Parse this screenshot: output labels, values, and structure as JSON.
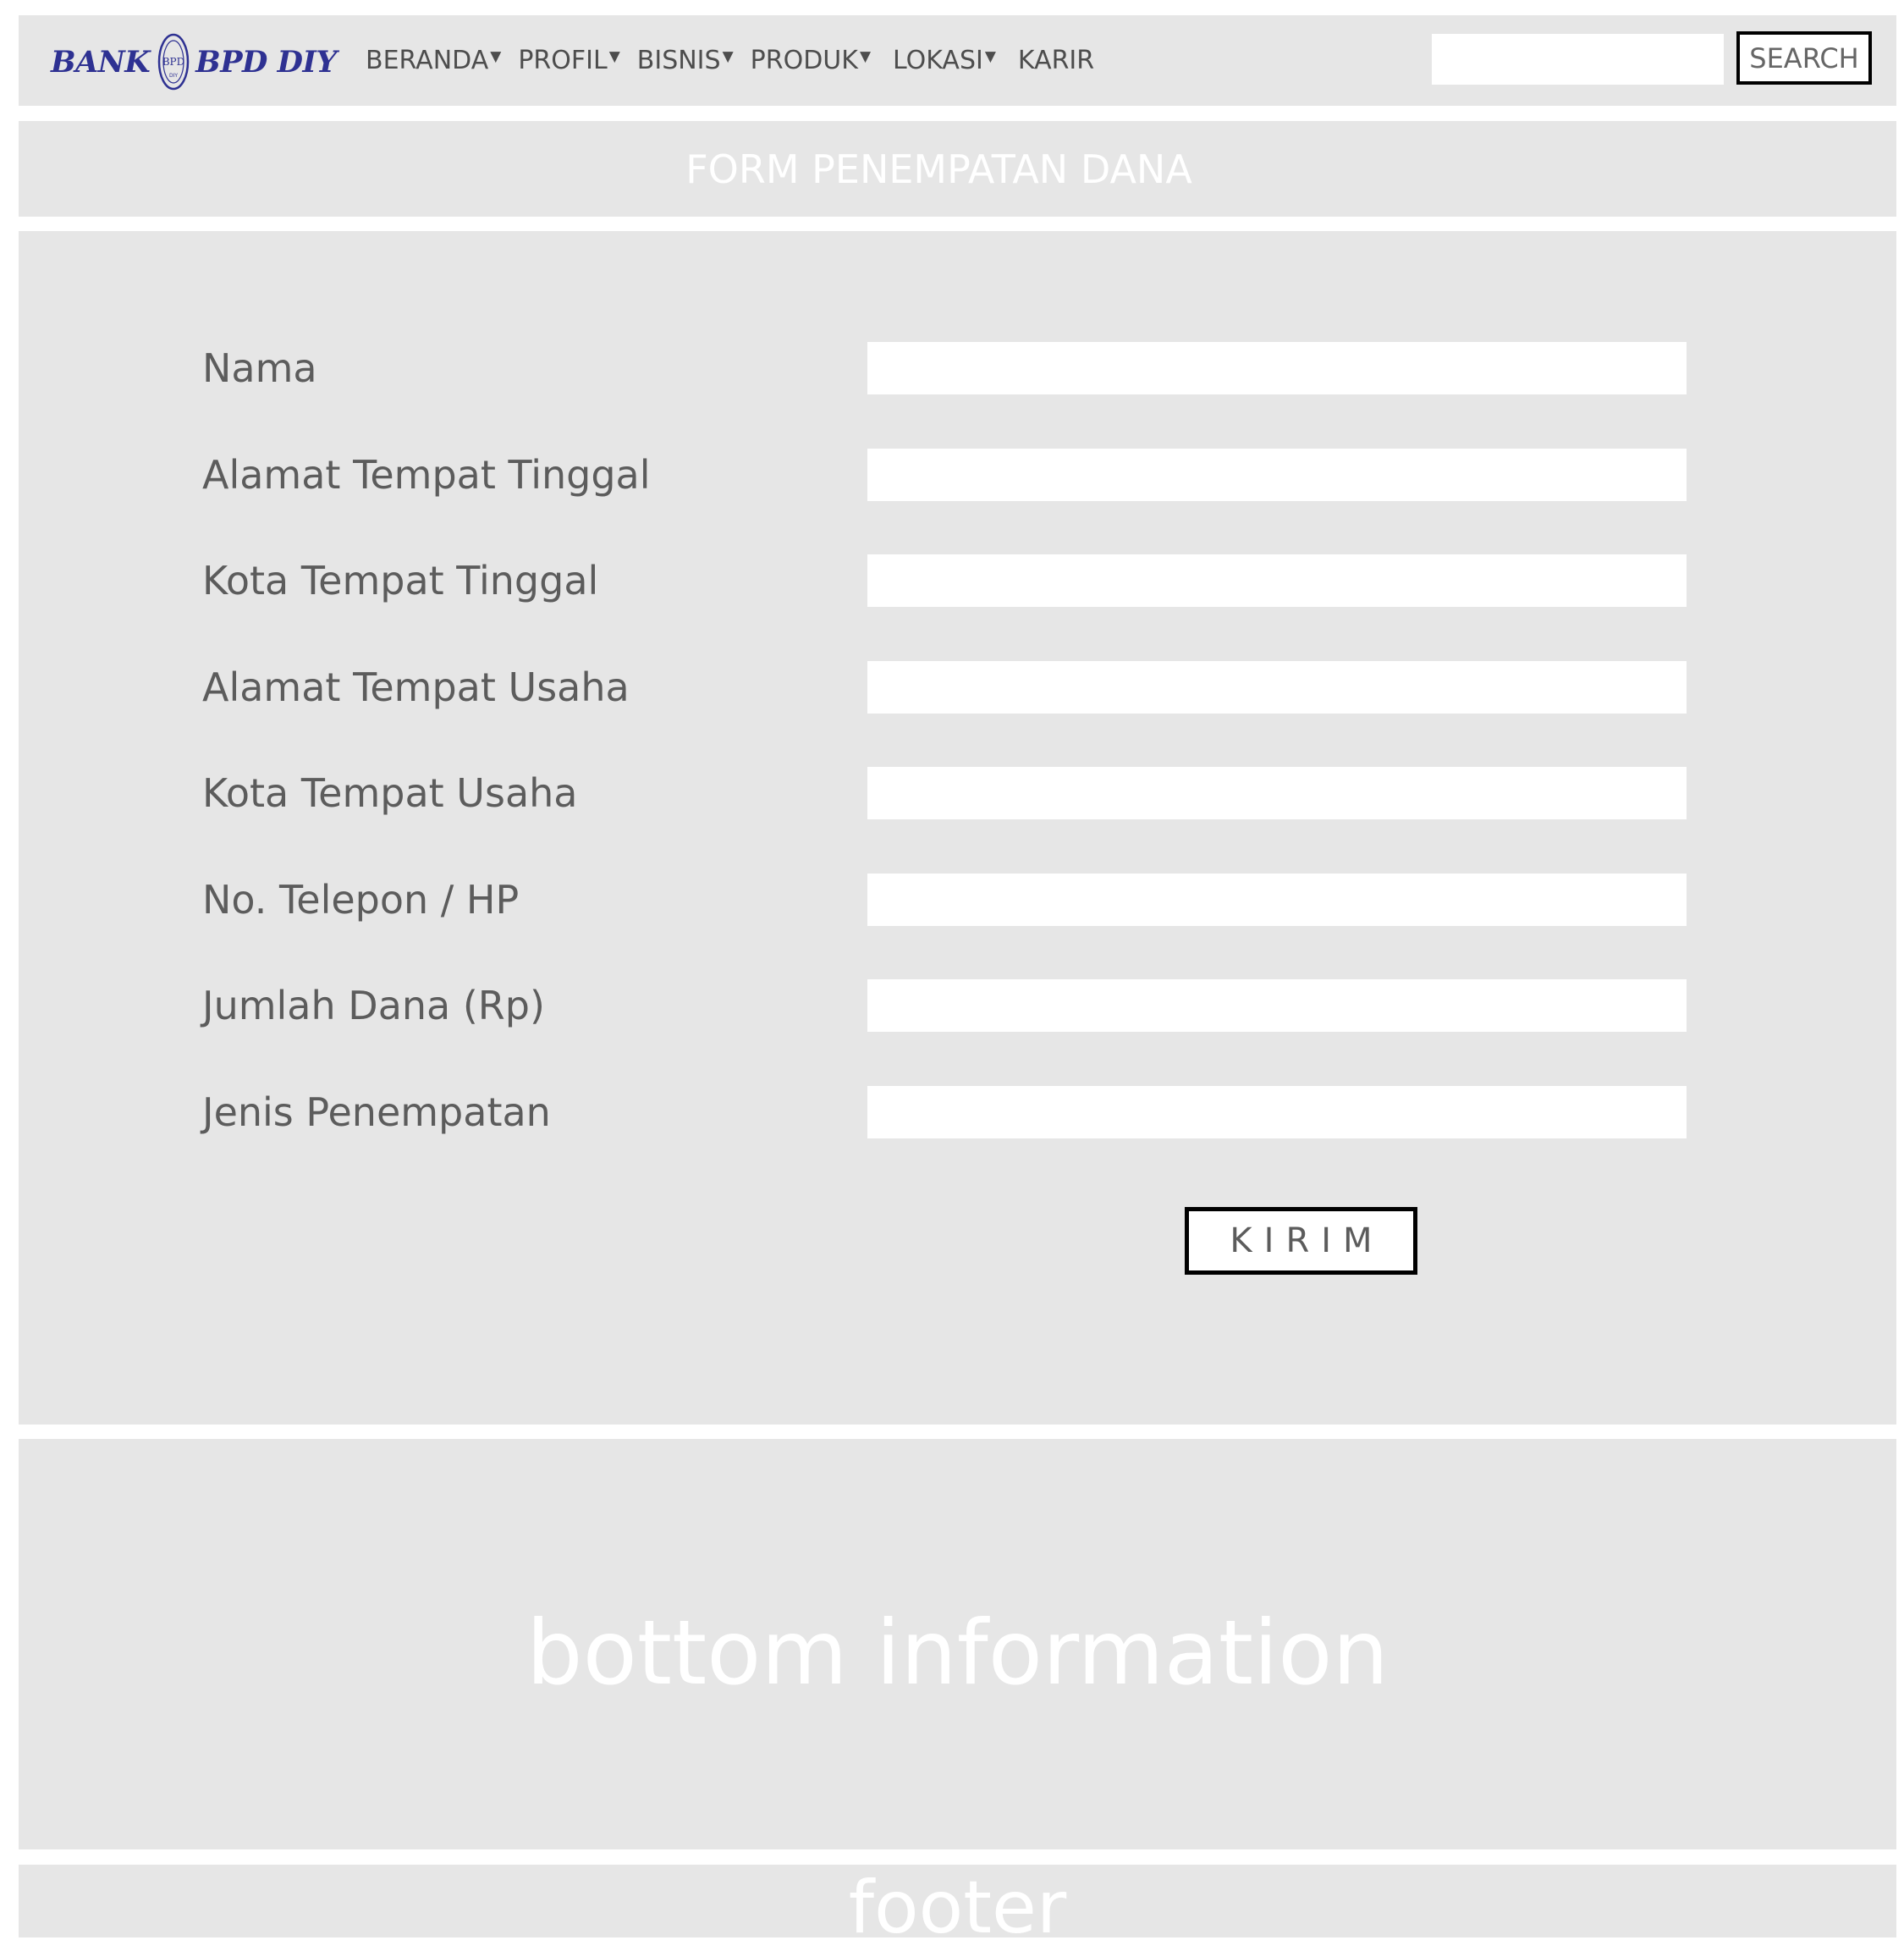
{
  "header": {
    "logo": {
      "left_text": "BANK",
      "right_text": "BPD DIY",
      "emblem_text": "BPD",
      "emblem_subtext": "DIY"
    },
    "nav": [
      {
        "label": "BERANDA",
        "dropdown": true
      },
      {
        "label": "PROFIL",
        "dropdown": true
      },
      {
        "label": "BISNIS",
        "dropdown": true
      },
      {
        "label": "PRODUK",
        "dropdown": true
      },
      {
        "label": "LOKASI",
        "dropdown": true
      },
      {
        "label": "KARIR",
        "dropdown": false
      }
    ],
    "search": {
      "value": "",
      "button_label": "SEARCH"
    },
    "caret": "▼"
  },
  "title_bar": {
    "title": "FORM PENEMPATAN DANA"
  },
  "form": {
    "fields": [
      {
        "label": "Nama",
        "value": ""
      },
      {
        "label": "Alamat Tempat Tinggal",
        "value": ""
      },
      {
        "label": "Kota Tempat Tinggal",
        "value": ""
      },
      {
        "label": "Alamat Tempat Usaha",
        "value": ""
      },
      {
        "label": "Kota Tempat Usaha",
        "value": ""
      },
      {
        "label": "No. Telepon / HP",
        "value": ""
      },
      {
        "label": "Jumlah Dana (Rp)",
        "value": ""
      },
      {
        "label": "Jenis Penempatan",
        "value": ""
      }
    ],
    "submit_label": "KIRIM"
  },
  "bottom": {
    "text": "bottom information"
  },
  "footer": {
    "text": "footer"
  },
  "colors": {
    "panel_bg": "#e6e6e6",
    "logo_blue": "#2e3192",
    "nav_text": "#4d4d4d",
    "label_text": "#5c5c5c",
    "placeholder_white": "#ffffff"
  }
}
